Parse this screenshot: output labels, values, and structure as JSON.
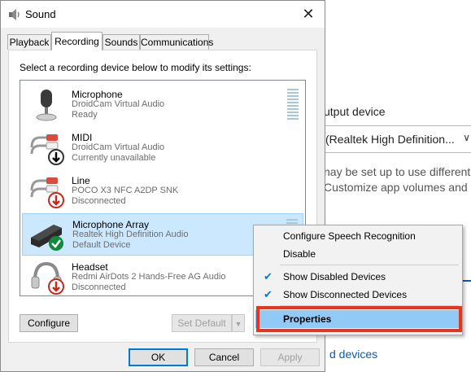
{
  "background_window": {
    "output_device_label": "utput device",
    "dropdown_value": "(Realtek High Definition...",
    "text_line1": "nay be set up to use different",
    "text_line2": "Customize app volumes and",
    "link": "d devices"
  },
  "dialog": {
    "title": "Sound",
    "close": "✕",
    "tabs": [
      {
        "label": "Playback",
        "active": false
      },
      {
        "label": "Recording",
        "active": true
      },
      {
        "label": "Sounds",
        "active": false
      },
      {
        "label": "Communications",
        "active": false
      }
    ],
    "instruction": "Select a recording device below to modify its settings:",
    "devices": [
      {
        "name": "Microphone",
        "driver": "DroidCam Virtual Audio",
        "status": "Ready",
        "icon": "microphone-icon",
        "badge": "none",
        "meter": true
      },
      {
        "name": "MIDI",
        "driver": "DroidCam Virtual Audio",
        "status": "Currently unavailable",
        "icon": "audio-jack-icon",
        "badge": "black-down-arrow",
        "meter": false
      },
      {
        "name": "Line",
        "driver": "POCO X3 NFC A2DP SNK",
        "status": "Disconnected",
        "icon": "audio-jack-icon",
        "badge": "red-down-arrow",
        "meter": false
      },
      {
        "name": "Microphone Array",
        "driver": "Realtek High Definition Audio",
        "status": "Default Device",
        "icon": "microphone-array-icon",
        "badge": "green-check",
        "meter": true,
        "selected": true
      },
      {
        "name": "Headset",
        "driver": "Redmi AirDots 2 Hands-Free AG Audio",
        "status": "Disconnected",
        "icon": "headset-icon",
        "badge": "red-down-arrow",
        "meter": false
      }
    ],
    "buttons": {
      "configure": "Configure",
      "set_default": "Set Default",
      "ok": "OK",
      "cancel": "Cancel",
      "apply": "Apply"
    }
  },
  "context_menu": {
    "items": [
      {
        "label": "Configure Speech Recognition",
        "checked": false
      },
      {
        "label": "Disable",
        "checked": false
      },
      {
        "label": "Show Disabled Devices",
        "checked": true
      },
      {
        "label": "Show Disconnected Devices",
        "checked": true
      },
      {
        "label": "Properties",
        "checked": false,
        "highlighted": true
      }
    ],
    "check_glyph": "✔"
  },
  "colors": {
    "selection": "#cce8ff",
    "menu_highlight": "#91c9f7",
    "annotation_red": "#e8341c",
    "accent": "#0078d7"
  }
}
